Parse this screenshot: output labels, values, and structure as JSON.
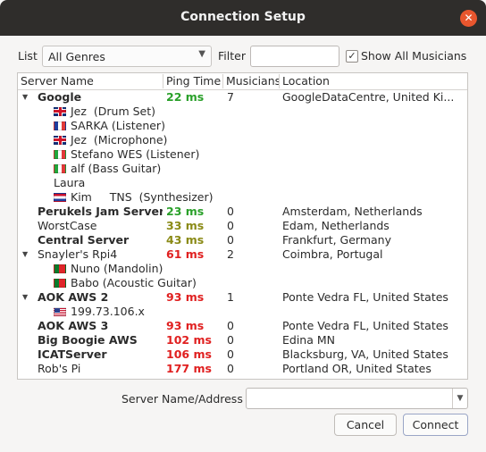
{
  "window": {
    "title": "Connection Setup"
  },
  "filters": {
    "list_label": "List",
    "list_value": "All Genres",
    "filter_label": "Filter",
    "filter_value": "",
    "show_all_label": "Show All Musicians",
    "show_all_checked": true
  },
  "table": {
    "headers": [
      "Server Name",
      "Ping Time",
      "Musicians",
      "Location"
    ],
    "rows": [
      {
        "type": "server",
        "name": "Google",
        "bold": true,
        "expanded": true,
        "ping": "22 ms",
        "ping_color": "#2aa02a",
        "musicians": "7",
        "location": "GoogleDataCentre, United Ki..."
      },
      {
        "type": "musician",
        "flag": "uk",
        "name": "Jez  (Drum Set)"
      },
      {
        "type": "musician",
        "flag": "fr",
        "name": "SARKA (Listener)"
      },
      {
        "type": "musician",
        "flag": "uk",
        "name": "Jez  (Microphone)"
      },
      {
        "type": "musician",
        "flag": "it",
        "name": "Stefano WES (Listener)"
      },
      {
        "type": "musician",
        "flag": "it",
        "name": "alf (Bass Guitar)"
      },
      {
        "type": "musician",
        "flag": "",
        "name": "Laura"
      },
      {
        "type": "musician",
        "flag": "nl",
        "name": "Kim     TNS  (Synthesizer)"
      },
      {
        "type": "server",
        "name": "Perukels Jam Server",
        "bold": true,
        "ping": "23 ms",
        "ping_color": "#2aa02a",
        "musicians": "0",
        "location": "Amsterdam, Netherlands"
      },
      {
        "type": "server",
        "name": "WorstCase",
        "bold": false,
        "ping": "33 ms",
        "ping_color": "#8a8a16",
        "musicians": "0",
        "location": "Edam, Netherlands"
      },
      {
        "type": "server",
        "name": "Central Server",
        "bold": true,
        "ping": "43 ms",
        "ping_color": "#8a8a16",
        "musicians": "0",
        "location": "Frankfurt, Germany"
      },
      {
        "type": "server",
        "name": "Snayler's Rpi4",
        "bold": false,
        "expanded": true,
        "ping": "61 ms",
        "ping_color": "#e02020",
        "musicians": "2",
        "location": "Coimbra, Portugal"
      },
      {
        "type": "musician",
        "flag": "pt",
        "name": "Nuno (Mandolin)"
      },
      {
        "type": "musician",
        "flag": "pt",
        "name": "Babo (Acoustic Guitar)"
      },
      {
        "type": "server",
        "name": "AOK AWS 2",
        "bold": true,
        "expanded": true,
        "ping": "93 ms",
        "ping_color": "#e02020",
        "musicians": "1",
        "location": "Ponte Vedra FL, United States"
      },
      {
        "type": "musician",
        "flag": "us",
        "name": "199.73.106.x"
      },
      {
        "type": "server",
        "name": "AOK AWS 3",
        "bold": true,
        "ping": "93 ms",
        "ping_color": "#e02020",
        "musicians": "0",
        "location": "Ponte Vedra FL, United States"
      },
      {
        "type": "server",
        "name": "Big Boogie AWS",
        "bold": true,
        "ping": "102 ms",
        "ping_color": "#e02020",
        "musicians": "0",
        "location": "Edina MN"
      },
      {
        "type": "server",
        "name": "ICATServer",
        "bold": true,
        "ping": "106 ms",
        "ping_color": "#e02020",
        "musicians": "0",
        "location": "Blacksburg, VA, United States"
      },
      {
        "type": "server",
        "name": "Rob's Pi",
        "bold": false,
        "ping": "177 ms",
        "ping_color": "#e02020",
        "musicians": "0",
        "location": "Portland OR, United States"
      }
    ]
  },
  "address": {
    "label": "Server Name/Address",
    "value": ""
  },
  "buttons": {
    "cancel": "Cancel",
    "connect": "Connect"
  },
  "colors": {
    "titlebar": "#2f2d2b",
    "close": "#e9562e"
  }
}
